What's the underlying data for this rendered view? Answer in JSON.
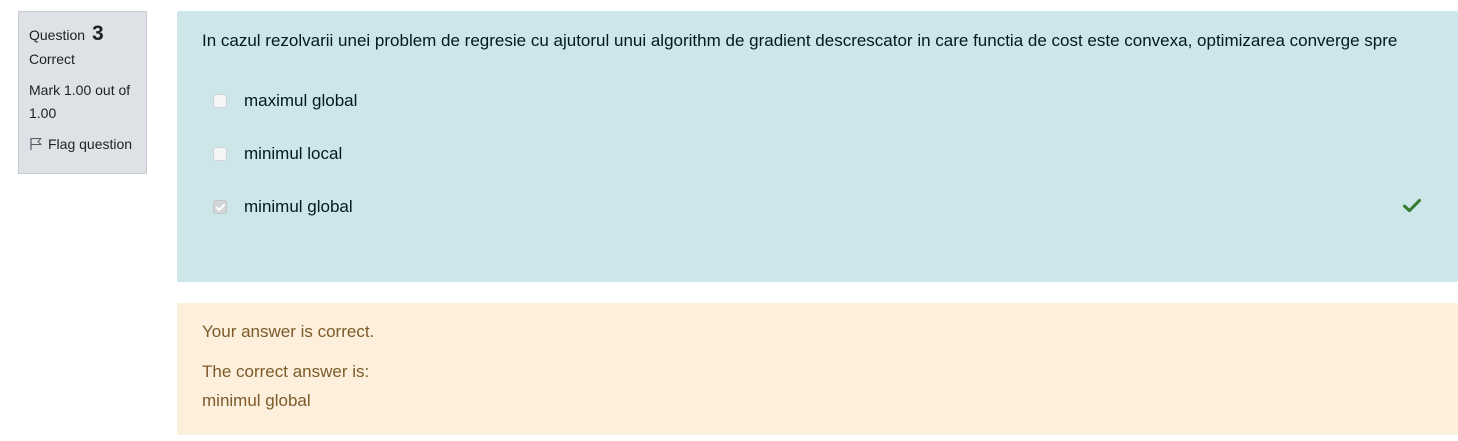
{
  "info": {
    "question_label": "Question",
    "question_number": "3",
    "state": "Correct",
    "grade": "Mark 1.00 out of 1.00",
    "flag_label": "Flag question"
  },
  "question": {
    "text": "In cazul rezolvarii unei problem de regresie cu ajutorul unui algorithm de gradient descrescator in care functia de cost este convexa, optimizarea converge spre",
    "answers": [
      {
        "label": "maximul global",
        "checked": false
      },
      {
        "label": "minimul local",
        "checked": false
      },
      {
        "label": "minimul global",
        "checked": true,
        "correct_icon": "check-icon"
      }
    ]
  },
  "feedback": {
    "specific": "Your answer is correct.",
    "right_answer_label": "The correct answer is:",
    "right_answer_value": "minimul global"
  },
  "colors": {
    "info_bg": "#dee2e6",
    "question_bg": "#cce6ea",
    "feedback_bg": "#fcefdc",
    "feedback_text": "#7d5a29",
    "check_green": "#357a32"
  }
}
